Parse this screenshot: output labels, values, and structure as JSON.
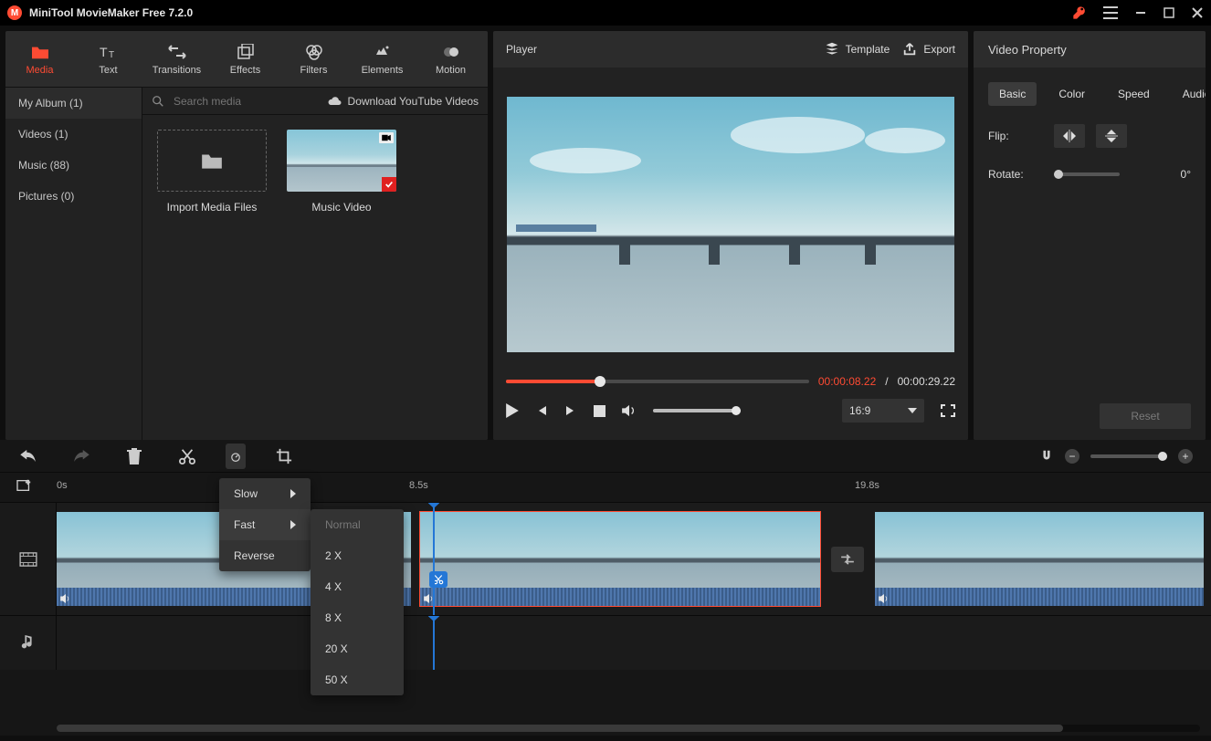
{
  "app": {
    "title": "MiniTool MovieMaker Free 7.2.0"
  },
  "tabs": [
    {
      "label": "Media"
    },
    {
      "label": "Text"
    },
    {
      "label": "Transitions"
    },
    {
      "label": "Effects"
    },
    {
      "label": "Filters"
    },
    {
      "label": "Elements"
    },
    {
      "label": "Motion"
    }
  ],
  "sidebar": {
    "items": [
      {
        "label": "My Album (1)"
      },
      {
        "label": "Videos (1)"
      },
      {
        "label": "Music (88)"
      },
      {
        "label": "Pictures (0)"
      }
    ]
  },
  "search": {
    "placeholder": "Search media"
  },
  "yt_link": "Download YouTube Videos",
  "thumbs": {
    "import": "Import Media Files",
    "clip1": "Music Video"
  },
  "player": {
    "title": "Player",
    "template_btn": "Template",
    "export_btn": "Export",
    "time_current": "00:00:08.22",
    "time_sep": " / ",
    "time_total": "00:00:29.22",
    "ratio": "16:9"
  },
  "prop": {
    "title": "Video Property",
    "tabs": [
      "Basic",
      "Color",
      "Speed",
      "Audio"
    ],
    "flip_label": "Flip:",
    "rotate_label": "Rotate:",
    "rotate_value": "0°",
    "reset": "Reset"
  },
  "ruler": {
    "t0": "0s",
    "t1": "8.5s",
    "t2": "19.8s"
  },
  "speed_menu": {
    "items": [
      "Slow",
      "Fast",
      "Reverse"
    ],
    "sub": [
      "Normal",
      "2 X",
      "4 X",
      "8 X",
      "20 X",
      "50 X"
    ]
  }
}
